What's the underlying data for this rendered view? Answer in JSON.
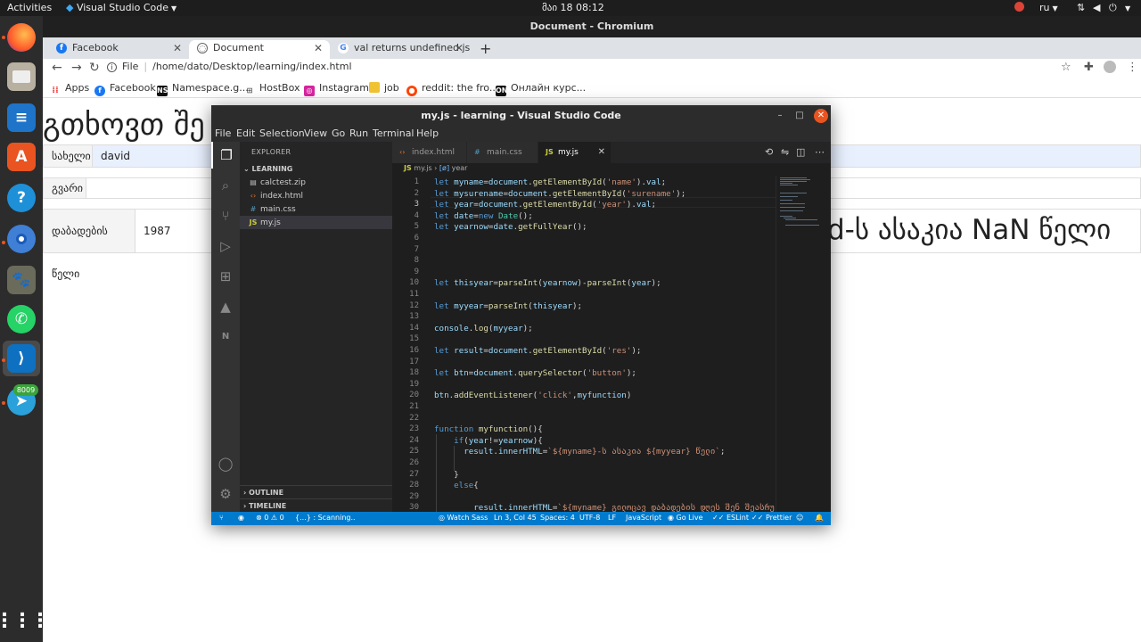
{
  "system": {
    "activities": "Activities",
    "app_menu": "Visual Studio Code",
    "clock": "მაი 18  08:12",
    "language": "ru"
  },
  "dock": {
    "telegram_badge": "8009",
    "apps": [
      "firefox-icon",
      "files-icon",
      "writer-icon",
      "software-icon",
      "help-icon",
      "chromium-icon",
      "gimp-icon",
      "whatsapp-icon",
      "vscode-icon",
      "telegram-icon",
      "app-grid-icon"
    ]
  },
  "browser": {
    "window_title": "Document - Chromium",
    "tabs": [
      {
        "label": "Facebook"
      },
      {
        "label": "Document"
      },
      {
        "label": "val returns undefined js -"
      }
    ],
    "address": {
      "scheme_label": "File",
      "path": "/home/dato/Desktop/learning/index.html"
    },
    "bookmarks": [
      {
        "label": "Apps"
      },
      {
        "label": "Facebook"
      },
      {
        "label": "Namespace.g..."
      },
      {
        "label": "HostBox"
      },
      {
        "label": "Instagram"
      },
      {
        "label": "job"
      },
      {
        "label": "reddit: the fro..."
      },
      {
        "label": "Онлайн курс..."
      }
    ]
  },
  "page": {
    "heading": "გთხოვთ შე",
    "result": "d-ს ასაკია NaN წელი",
    "fields": [
      {
        "label": "სახელი",
        "value": "david"
      },
      {
        "label": "გვარი",
        "value": ""
      },
      {
        "label": "დაბადების წელი",
        "value": "1987"
      }
    ]
  },
  "vscode": {
    "title": "my.js - learning - Visual Studio Code",
    "menu": [
      "File",
      "Edit",
      "Selection",
      "View",
      "Go",
      "Run",
      "Terminal",
      "Help"
    ],
    "explorer_label": "EXPLORER",
    "folder": "LEARNING",
    "files": [
      "calctest.zip",
      "index.html",
      "main.css",
      "my.js"
    ],
    "outline_label": "OUTLINE",
    "timeline_label": "TIMELINE",
    "editor_tabs": [
      "index.html",
      "main.css",
      "my.js"
    ],
    "breadcrumb": {
      "file": "my.js",
      "symbol": "year"
    },
    "status": {
      "errors": "0",
      "warnings": "0",
      "scanning": "{...} : Scanning..",
      "watch_sass": "Watch Sass",
      "position": "Ln 3, Col 45",
      "spaces": "Spaces: 4",
      "encoding": "UTF-8",
      "eol": "LF",
      "language": "JavaScript",
      "go_live": "Go Live",
      "eslint": "ESLint",
      "prettier": "Prettier"
    },
    "code_lines": [
      {
        "n": "1",
        "text": "let myname=document.getElementById('name').val;"
      },
      {
        "n": "2",
        "text": "let mysurename=document.getElementById('surename');"
      },
      {
        "n": "3",
        "text": "let year=document.getElementById('year').val;"
      },
      {
        "n": "4",
        "text": "let date=new Date();"
      },
      {
        "n": "5",
        "text": "let yearnow=date.getFullYear();"
      },
      {
        "n": "6",
        "text": ""
      },
      {
        "n": "7",
        "text": ""
      },
      {
        "n": "8",
        "text": ""
      },
      {
        "n": "9",
        "text": ""
      },
      {
        "n": "10",
        "text": "let thisyear=parseInt(yearnow)-parseInt(year);"
      },
      {
        "n": "11",
        "text": ""
      },
      {
        "n": "12",
        "text": "let myyear=parseInt(thisyear);"
      },
      {
        "n": "13",
        "text": ""
      },
      {
        "n": "14",
        "text": "console.log(myyear);"
      },
      {
        "n": "15",
        "text": ""
      },
      {
        "n": "16",
        "text": "let result=document.getElementById('res');"
      },
      {
        "n": "17",
        "text": ""
      },
      {
        "n": "18",
        "text": "let btn=document.querySelector('button');"
      },
      {
        "n": "19",
        "text": ""
      },
      {
        "n": "20",
        "text": "btn.addEventListener('click',myfunction)"
      },
      {
        "n": "21",
        "text": ""
      },
      {
        "n": "22",
        "text": ""
      },
      {
        "n": "23",
        "text": "function myfunction(){"
      },
      {
        "n": "24",
        "text": "    if(year!=yearnow){"
      },
      {
        "n": "25",
        "text": "      result.innerHTML=`${myname}-ს ასაკია ${myyear} წელი`;"
      },
      {
        "n": "26",
        "text": ""
      },
      {
        "n": "27",
        "text": "    }"
      },
      {
        "n": "28",
        "text": "    else{"
      },
      {
        "n": "29",
        "text": ""
      },
      {
        "n": "30",
        "text": "        result.innerHTML=`${myname} გილოცავ დაბადების დღეს შენ შეასრუ"
      }
    ]
  }
}
